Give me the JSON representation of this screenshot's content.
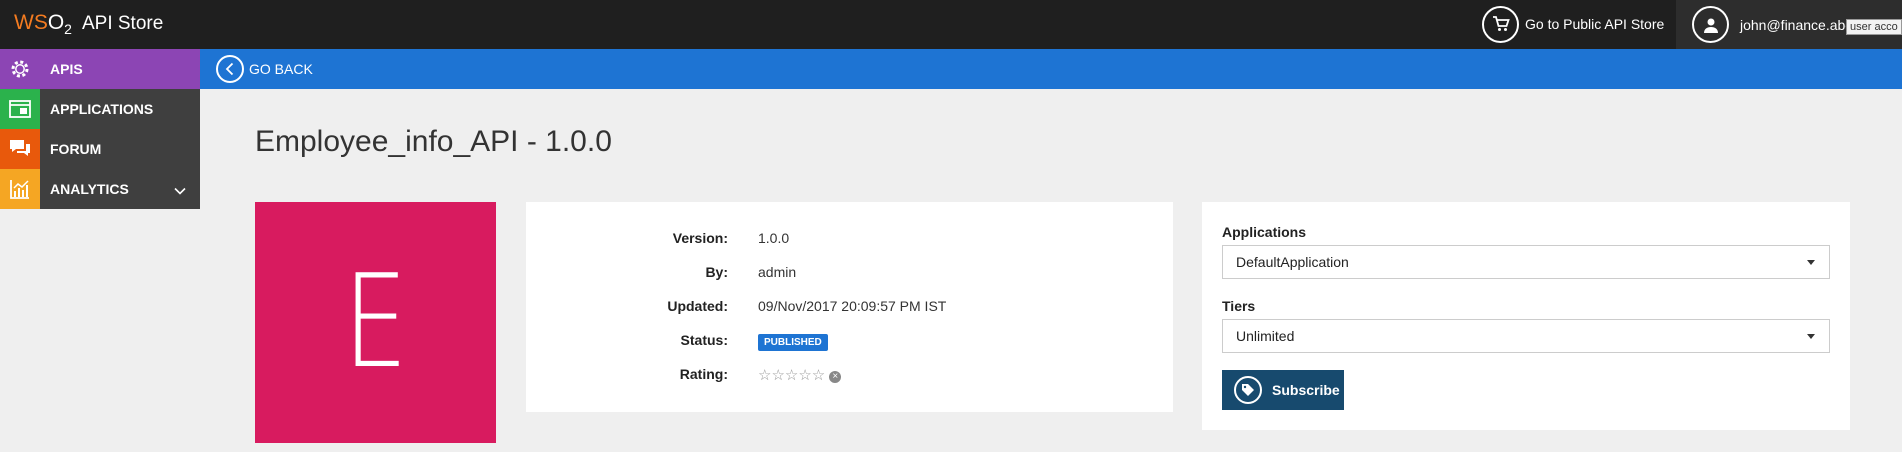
{
  "header": {
    "logo_text": "WSO2",
    "app_name": "API Store",
    "public_store_link": "Go to Public API Store",
    "user_email": "john@finance.abc",
    "user_tooltip": "user acco"
  },
  "nav": {
    "go_back": "GO BACK"
  },
  "sidebar": {
    "items": [
      {
        "label": "APIS",
        "icon": "apis-gear-icon",
        "color": "#8c45b4"
      },
      {
        "label": "APPLICATIONS",
        "icon": "applications-icon",
        "color": "#2bb24c"
      },
      {
        "label": "FORUM",
        "icon": "forum-chat-icon",
        "color": "#e8590c"
      },
      {
        "label": "ANALYTICS",
        "icon": "analytics-chart-icon",
        "color": "#f5a623"
      }
    ]
  },
  "api": {
    "title": "Employee_info_API - 1.0.0",
    "thumbnail_letter": "E",
    "thumbnail_color": "#d81b5f",
    "details": {
      "version_label": "Version:",
      "version": "1.0.0",
      "by_label": "By:",
      "by": "admin",
      "updated_label": "Updated:",
      "updated": "09/Nov/2017 20:09:57 PM IST",
      "status_label": "Status:",
      "status": "PUBLISHED",
      "rating_label": "Rating:",
      "rating_value": 0,
      "rating_max": 5
    }
  },
  "subscribe": {
    "applications_label": "Applications",
    "application_selected": "DefaultApplication",
    "tiers_label": "Tiers",
    "tier_selected": "Unlimited",
    "button_label": "Subscribe"
  }
}
